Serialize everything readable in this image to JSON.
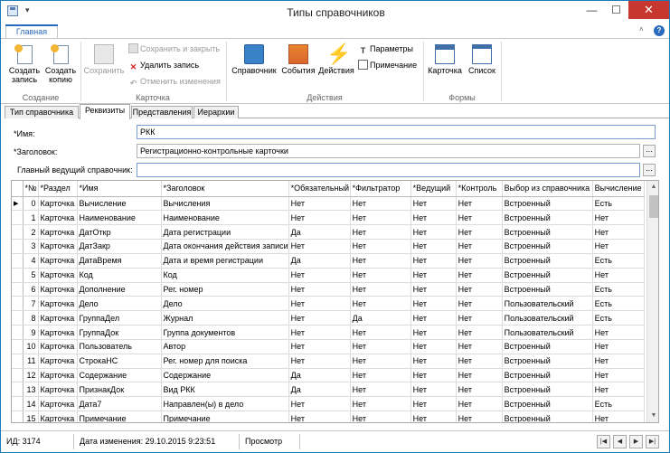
{
  "window": {
    "title": "Типы справочников",
    "minimize": "—",
    "maximize": "☐",
    "close": "✕"
  },
  "ribbon": {
    "tab_main": "Главная",
    "groups": {
      "create": {
        "label": "Создание",
        "create_record_l1": "Создать",
        "create_record_l2": "запись",
        "create_copy_l1": "Создать",
        "create_copy_l2": "копию"
      },
      "card": {
        "label": "Карточка",
        "save": "Сохранить",
        "save_close": "Сохранить и закрыть",
        "delete": "Удалить запись",
        "undo": "Отменить изменения"
      },
      "actions": {
        "label": "Действия",
        "reference": "Справочник",
        "events": "События",
        "actions": "Действия",
        "parameters": "Параметры",
        "note": "Примечание"
      },
      "forms": {
        "label": "Формы",
        "card": "Карточка",
        "list": "Список"
      }
    }
  },
  "tabs": [
    "Тип справочника",
    "Реквизиты",
    "Представления",
    "Иерархии"
  ],
  "form": {
    "name_label": "*Имя:",
    "name_value": "РКК",
    "title_label": "*Заголовок:",
    "title_value": "Регистрационно-контрольные карточки",
    "master_label": "Главный ведущий справочник:",
    "master_value": ""
  },
  "grid": {
    "columns": [
      "*№",
      "*Раздел",
      "*Имя",
      "*Заголовок",
      "*Обязательный",
      "*Фильтратор",
      "*Ведущий",
      "*Контроль",
      "Выбор из справочника",
      "Вычисление"
    ],
    "rows": [
      [
        "0",
        "Карточка",
        "Вычисление",
        "Вычисления",
        "Нет",
        "Нет",
        "Нет",
        "Нет",
        "Встроенный",
        "Есть"
      ],
      [
        "1",
        "Карточка",
        "Наименование",
        "Наименование",
        "Нет",
        "Нет",
        "Нет",
        "Нет",
        "Встроенный",
        "Нет"
      ],
      [
        "2",
        "Карточка",
        "ДатОткр",
        "Дата регистрации",
        "Да",
        "Нет",
        "Нет",
        "Нет",
        "Встроенный",
        "Нет"
      ],
      [
        "3",
        "Карточка",
        "ДатЗакр",
        "Дата окончания действия записи",
        "Нет",
        "Нет",
        "Нет",
        "Нет",
        "Встроенный",
        "Нет"
      ],
      [
        "4",
        "Карточка",
        "ДатаВремя",
        "Дата и время регистрации",
        "Да",
        "Нет",
        "Нет",
        "Нет",
        "Встроенный",
        "Есть"
      ],
      [
        "5",
        "Карточка",
        "Код",
        "Код",
        "Нет",
        "Нет",
        "Нет",
        "Нет",
        "Встроенный",
        "Нет"
      ],
      [
        "6",
        "Карточка",
        "Дополнение",
        "Рег. номер",
        "Нет",
        "Нет",
        "Нет",
        "Нет",
        "Встроенный",
        "Есть"
      ],
      [
        "7",
        "Карточка",
        "Дело",
        "Дело",
        "Нет",
        "Нет",
        "Нет",
        "Нет",
        "Пользовательский",
        "Есть"
      ],
      [
        "8",
        "Карточка",
        "ГруппаДел",
        "Журнал",
        "Нет",
        "Да",
        "Нет",
        "Нет",
        "Пользовательский",
        "Есть"
      ],
      [
        "9",
        "Карточка",
        "ГруппаДок",
        "Группа документов",
        "Нет",
        "Нет",
        "Нет",
        "Нет",
        "Пользовательский",
        "Нет"
      ],
      [
        "10",
        "Карточка",
        "Пользователь",
        "Автор",
        "Нет",
        "Нет",
        "Нет",
        "Нет",
        "Встроенный",
        "Нет"
      ],
      [
        "11",
        "Карточка",
        "СтрокаНС",
        "Рег. номер для поиска",
        "Нет",
        "Нет",
        "Нет",
        "Нет",
        "Встроенный",
        "Нет"
      ],
      [
        "12",
        "Карточка",
        "Содержание",
        "Содержание",
        "Да",
        "Нет",
        "Нет",
        "Нет",
        "Встроенный",
        "Нет"
      ],
      [
        "13",
        "Карточка",
        "ПризнакДок",
        "Вид РКК",
        "Да",
        "Нет",
        "Нет",
        "Нет",
        "Встроенный",
        "Нет"
      ],
      [
        "14",
        "Карточка",
        "Дата7",
        "Направлен(ы) в дело",
        "Нет",
        "Нет",
        "Нет",
        "Нет",
        "Встроенный",
        "Есть"
      ],
      [
        "15",
        "Карточка",
        "Примечание",
        "Примечание",
        "Нет",
        "Нет",
        "Нет",
        "Нет",
        "Встроенный",
        "Нет"
      ]
    ],
    "selected_row": 0
  },
  "status": {
    "id": "ИД: 3174",
    "modified": "Дата изменения: 29.10.2015 9:23:51",
    "mode": "Просмотр"
  },
  "colors": {
    "accent": "#2a6bbd",
    "close_button": "#c7372f",
    "window_border": "#1d7ab8"
  }
}
